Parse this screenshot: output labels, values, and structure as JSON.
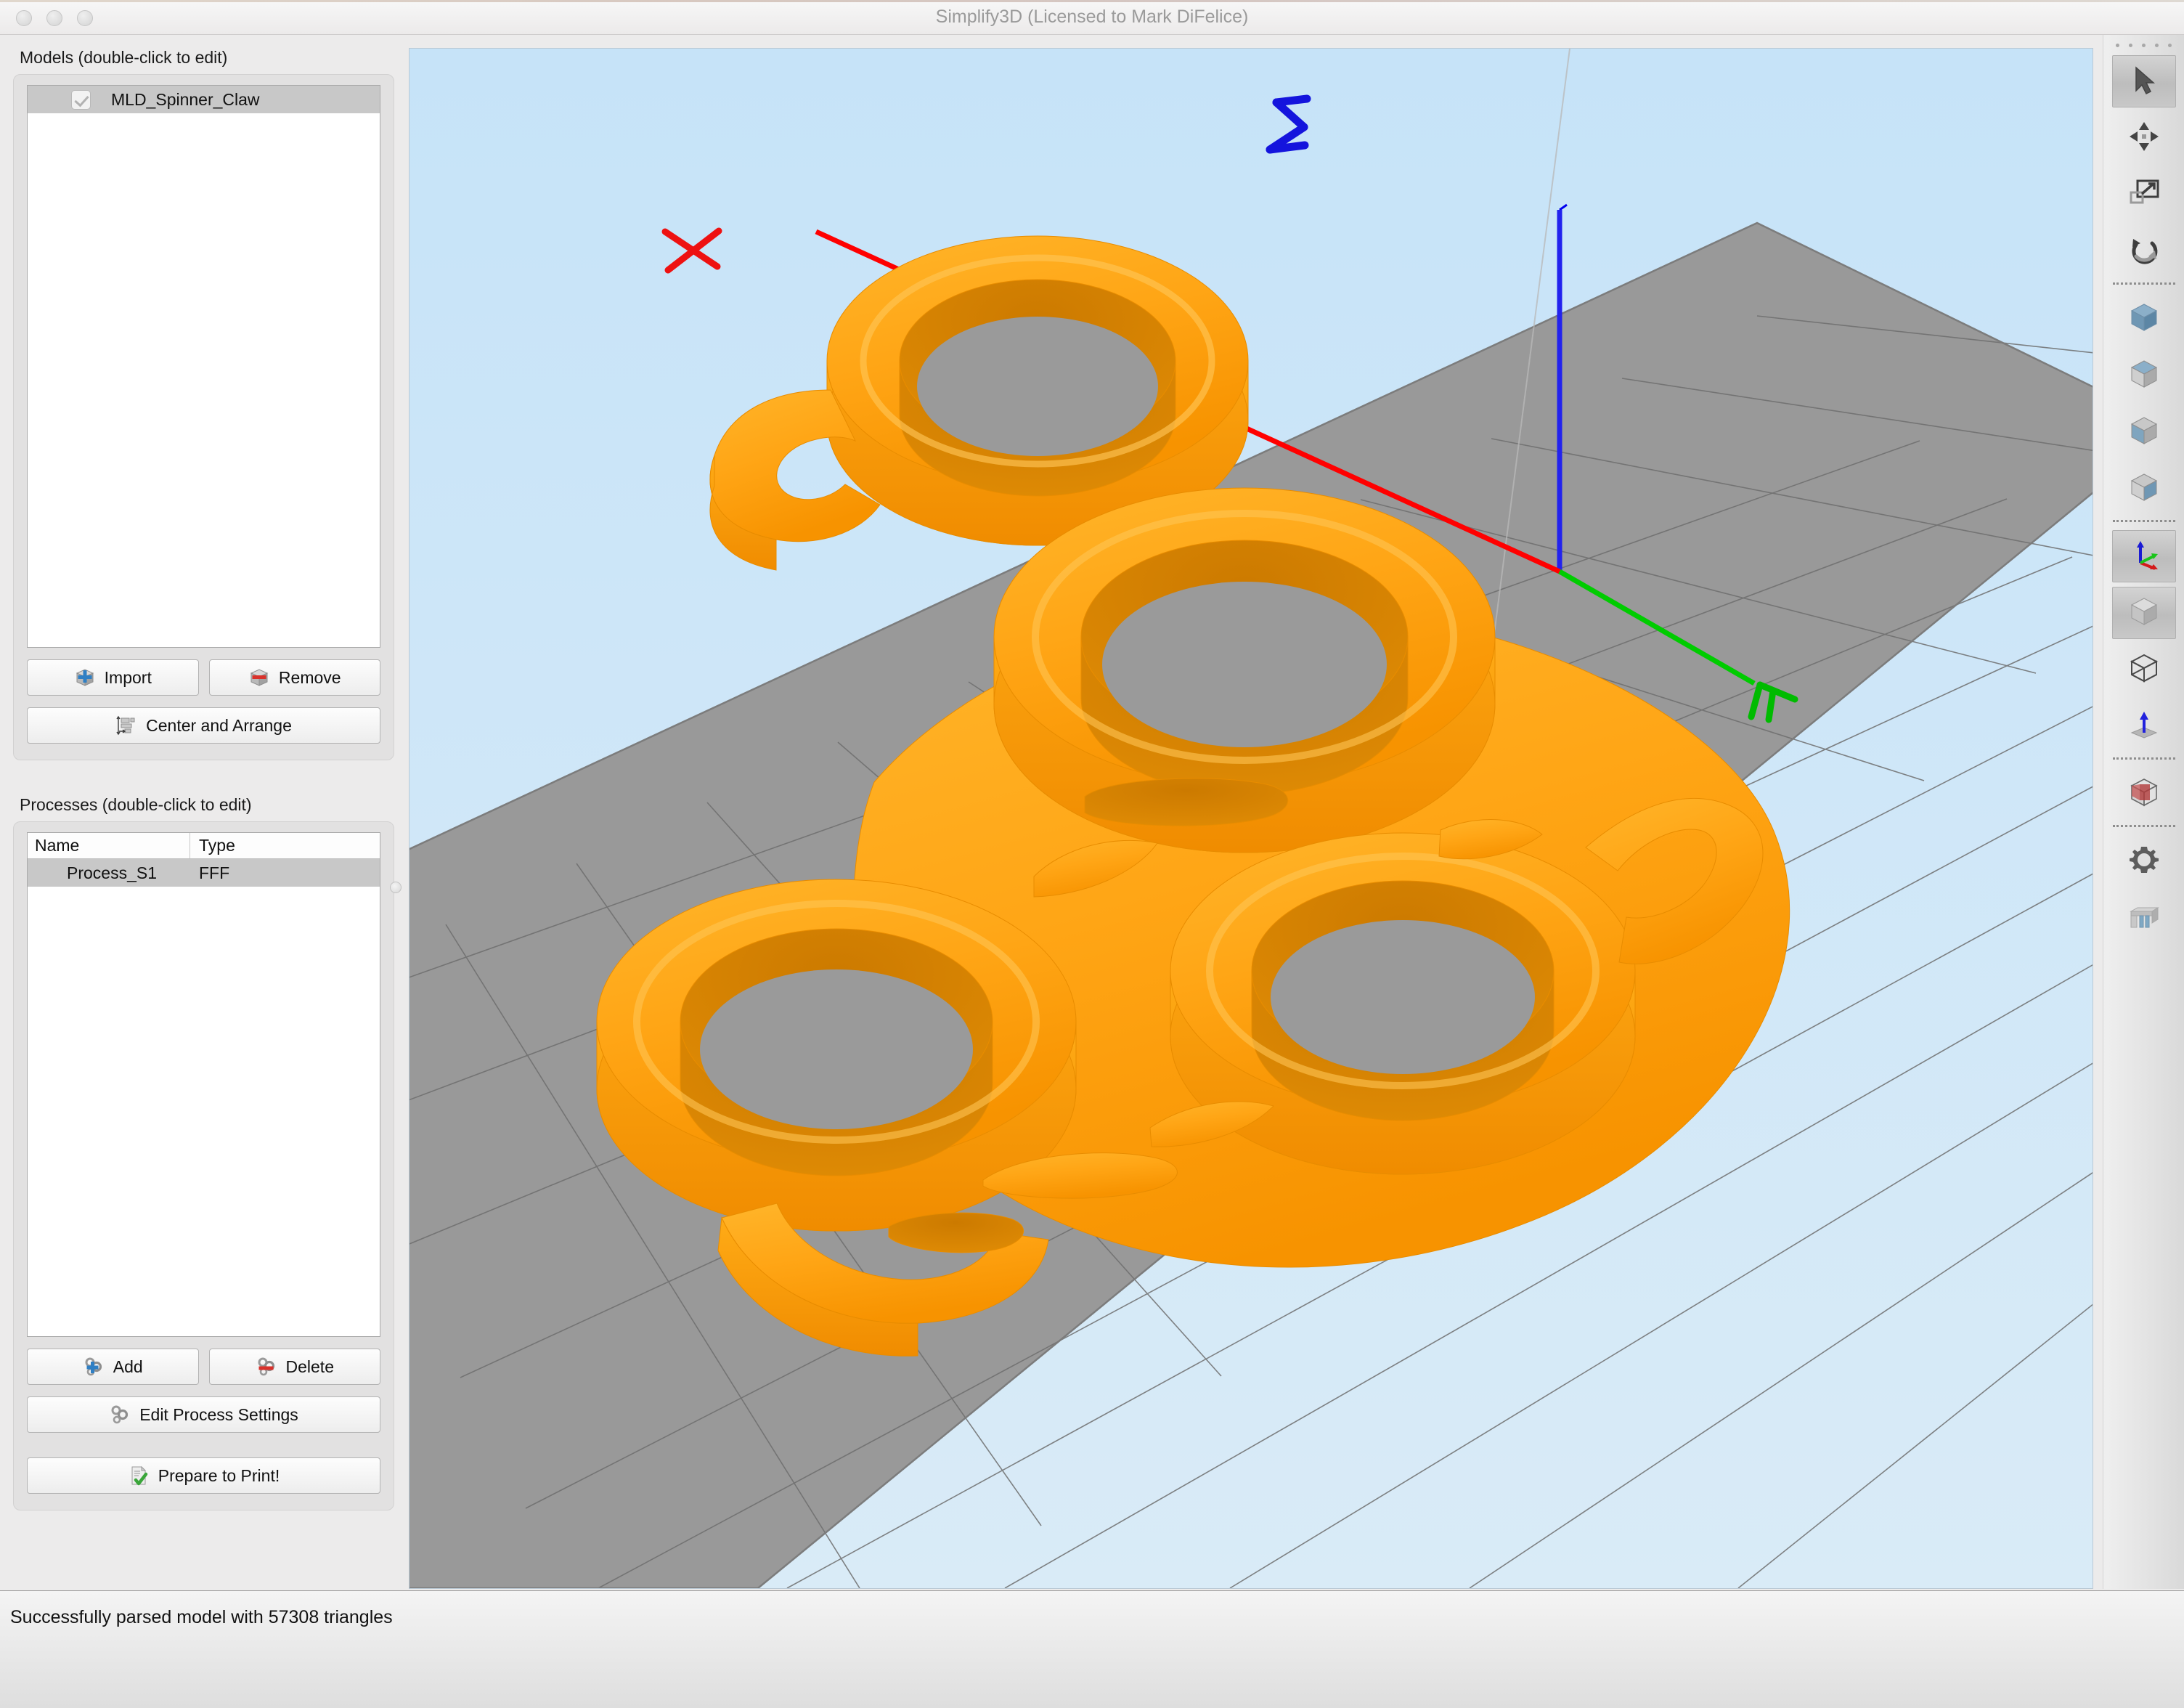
{
  "window": {
    "title": "Simplify3D (Licensed to Mark DiFelice)",
    "controls": [
      "close-button",
      "minimize-button",
      "zoom-button"
    ]
  },
  "models_panel": {
    "label": "Models (double-click to edit)",
    "items": [
      {
        "name": "MLD_Spinner_Claw",
        "checked": true,
        "selected": true
      }
    ],
    "buttons": {
      "import": "Import",
      "remove": "Remove",
      "center_and_arrange": "Center and Arrange"
    }
  },
  "processes_panel": {
    "label": "Processes (double-click to edit)",
    "columns": [
      "Name",
      "Type"
    ],
    "rows": [
      {
        "name": "Process_S1",
        "type": "FFF",
        "selected": true
      }
    ],
    "buttons": {
      "add": "Add",
      "delete": "Delete",
      "edit_process_settings": "Edit Process Settings",
      "prepare_to_print": "Prepare to Print!"
    }
  },
  "viewport": {
    "sky_color": "#cbe5f8",
    "plate_color": "#999999",
    "grid_color": "#6b6b6b",
    "model_color": "#ffa40d",
    "model_shadow_color": "#d98000",
    "axes": {
      "x": {
        "color": "#ff0000",
        "label": "X"
      },
      "y": {
        "color": "#00cc00",
        "label": "Y"
      },
      "z": {
        "color": "#0000ee",
        "label": "Z"
      }
    }
  },
  "toolbar": {
    "items": [
      {
        "name": "select-tool",
        "icon": "cursor-arrow-icon",
        "active": true
      },
      {
        "name": "move-tool",
        "icon": "move-arrows-icon",
        "active": false
      },
      {
        "name": "scale-tool",
        "icon": "scale-icon",
        "active": false
      },
      {
        "name": "rotate-tool",
        "icon": "rotate-icon",
        "active": false
      },
      {
        "name": "view-isometric",
        "icon": "cube-iso-icon",
        "active": false
      },
      {
        "name": "view-top",
        "icon": "cube-top-icon",
        "active": false
      },
      {
        "name": "view-front",
        "icon": "cube-front-icon",
        "active": false
      },
      {
        "name": "view-side",
        "icon": "cube-side-icon",
        "active": false
      },
      {
        "name": "show-axes",
        "icon": "axes-icon",
        "active": true
      },
      {
        "name": "solid-view",
        "icon": "cube-solid-icon",
        "active": true
      },
      {
        "name": "wireframe-view",
        "icon": "cube-wireframe-icon",
        "active": false
      },
      {
        "name": "origin-view",
        "icon": "z-arrow-plane-icon",
        "active": false
      },
      {
        "name": "cross-section",
        "icon": "cube-cross-section-icon",
        "active": false
      },
      {
        "name": "machine-settings",
        "icon": "gear-icon",
        "active": false
      },
      {
        "name": "support-generation",
        "icon": "support-structure-icon",
        "active": false
      }
    ]
  },
  "statusbar": {
    "message": "Successfully parsed model with 57308 triangles"
  }
}
